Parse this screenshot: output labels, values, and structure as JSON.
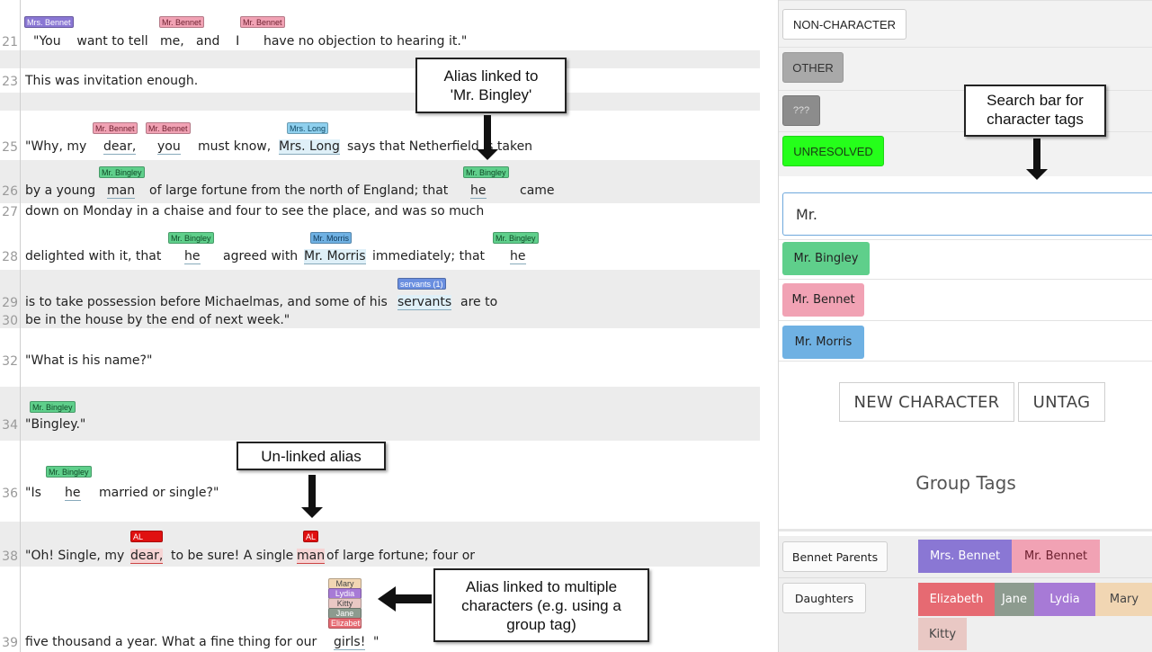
{
  "text_panel": {
    "lines": [
      {
        "num": "21",
        "text": "\"You    want to tell   me,   and    I      have no objection to hearing it.\""
      },
      {
        "num": "23",
        "text": "This was invitation enough."
      },
      {
        "num": "25",
        "text_a": "\"Why, my ",
        "dear": "dear,",
        "you": "you",
        "text_b": "must know,",
        "mrs_long": "Mrs. Long",
        "text_c": "says that Netherfield is taken"
      },
      {
        "num": "26",
        "text_a": "by a young",
        "man": "man",
        "text_b": "of large fortune from the north of England; that",
        "he": "he",
        "text_c": "came"
      },
      {
        "num": "27",
        "text": "down on Monday in a chaise and four to see the place, and was so much"
      },
      {
        "num": "28",
        "text_a": "delighted with it, that",
        "he1": "he",
        "text_b": "agreed with",
        "mr_morris": "Mr. Morris",
        "text_c": "immediately; that",
        "he2": "he"
      },
      {
        "num": "29",
        "text_a": "is to take possession before Michaelmas, and some of his",
        "servants": "servants",
        "text_b": "are to"
      },
      {
        "num": "30",
        "text": "be in the house by the end of next week.\""
      },
      {
        "num": "32",
        "text": "\"What is his name?\""
      },
      {
        "num": "34",
        "text": "\"Bingley.\""
      },
      {
        "num": "36",
        "text_a": "\"Is",
        "he": "he",
        "text_b": "married or single?\""
      },
      {
        "num": "38",
        "text_a": "\"Oh! Single, my",
        "dear": "dear,",
        "text_b": "to be sure! A single",
        "man": "man",
        "text_c": "of large fortune; four or"
      },
      {
        "num": "39",
        "text_a": "five thousand a year. What a fine thing for our",
        "girls": "girls!",
        "text_b": "\""
      }
    ],
    "tags": {
      "mrs_bennet": "Mrs. Bennet",
      "mr_bennet": "Mr. Bennet",
      "mr_bingley": "Mr. Bingley",
      "mrs_long": "Mrs. Long",
      "mr_morris": "Mr. Morris",
      "servants": "servants (1)",
      "al": "AL",
      "stacked": [
        "Mary",
        "Lydia",
        "Kitty",
        "Jane",
        "Elizabeth"
      ]
    }
  },
  "callouts": {
    "alias_linked": "Alias linked to\n'Mr. Bingley'",
    "unlinked": "Un-linked alias",
    "multi": "Alias linked to multiple\ncharacters (e.g. using a\ngroup tag)",
    "search_bar": "Search bar for\ncharacter tags"
  },
  "right_panel": {
    "non_character": "NON-CHARACTER",
    "other": "OTHER",
    "unknown": "???",
    "unresolved": "UNRESOLVED",
    "search_value": "Mr.",
    "results": [
      "Mr. Bingley",
      "Mr. Bennet",
      "Mr. Morris"
    ],
    "new_character": "NEW CHARACTER",
    "untag": "UNTAG",
    "group_tags_title": "Group Tags",
    "groups": [
      {
        "label": "Bennet Parents",
        "members": [
          "Mrs. Bennet",
          "Mr. Bennet"
        ]
      },
      {
        "label": "Daughters",
        "members": [
          "Elizabeth",
          "Jane",
          "Lydia",
          "Mary",
          "Kitty"
        ]
      }
    ]
  },
  "colors": {
    "mrs_bennet": "#8a77d4",
    "mr_bennet": "#f1a2b4",
    "mr_bingley": "#5fcf8b",
    "mr_morris": "#6fb1e3",
    "unresolved": "#25ff1a",
    "elizabeth": "#e66a72",
    "jane": "#8d9b8f",
    "lydia": "#a77ad6",
    "mary": "#f1d6b3",
    "kitty": "#e9c8c4"
  }
}
